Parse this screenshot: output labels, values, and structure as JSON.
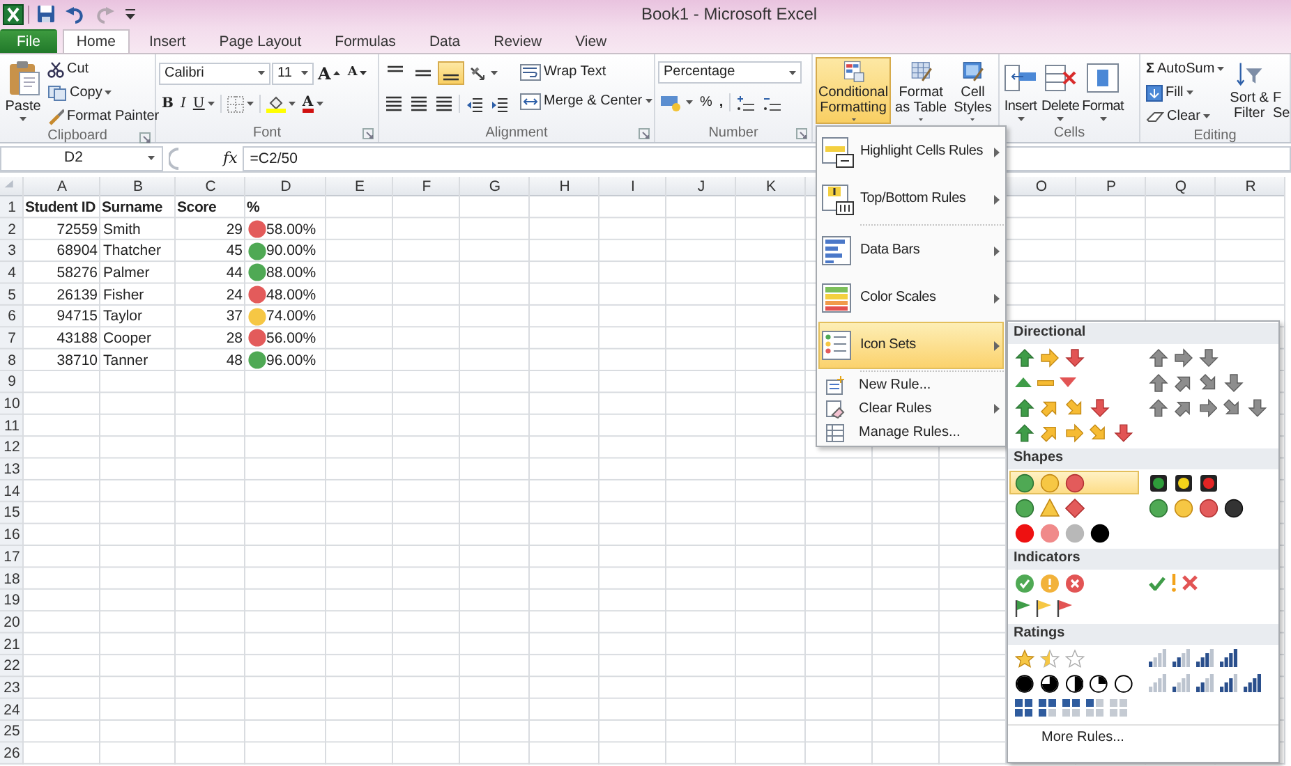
{
  "window": {
    "title": "Book1  -  Microsoft Excel"
  },
  "quick_access": [
    {
      "kind": "save",
      "disabled": false
    },
    {
      "kind": "undo",
      "disabled": false
    },
    {
      "kind": "redo",
      "disabled": true
    },
    {
      "kind": "customize",
      "disabled": false
    }
  ],
  "tabs": [
    {
      "label": "File",
      "kind": "file",
      "selected": false
    },
    {
      "label": "Home",
      "kind": "tab",
      "selected": true
    },
    {
      "label": "Insert",
      "kind": "tab",
      "selected": false
    },
    {
      "label": "Page Layout",
      "kind": "tab",
      "selected": false
    },
    {
      "label": "Formulas",
      "kind": "tab",
      "selected": false
    },
    {
      "label": "Data",
      "kind": "tab",
      "selected": false
    },
    {
      "label": "Review",
      "kind": "tab",
      "selected": false
    },
    {
      "label": "View",
      "kind": "tab",
      "selected": false
    }
  ],
  "ribbon": {
    "clipboard": {
      "paste": "Paste",
      "cut": "Cut",
      "copy": "Copy",
      "format_painter": "Format Painter",
      "label": "Clipboard"
    },
    "font": {
      "family": "Calibri",
      "size": "11",
      "grow": "A",
      "shrink": "A",
      "bold": "B",
      "italic": "I",
      "underline": "U",
      "color_button": "A",
      "label": "Font"
    },
    "alignment": {
      "vertical": [
        {
          "kind": "top",
          "selected": false
        },
        {
          "kind": "middle",
          "selected": false
        },
        {
          "kind": "bottom",
          "selected": true
        }
      ],
      "wrap_text": "Wrap Text",
      "merge": "Merge & Center",
      "label": "Alignment"
    },
    "number": {
      "format": "Percentage",
      "percent": "%",
      "comma": ",",
      "label": "Number"
    },
    "styles": [
      {
        "lines": [
          "Conditional",
          "Formatting"
        ],
        "kind": "conditional",
        "selected": true
      },
      {
        "lines": [
          "Format",
          "as Table"
        ],
        "kind": "table",
        "selected": false
      },
      {
        "lines": [
          "Cell",
          "Styles"
        ],
        "kind": "cellstyles",
        "selected": false
      }
    ],
    "cells": {
      "buttons": [
        {
          "label": "Insert",
          "kind": "insert"
        },
        {
          "label": "Delete",
          "kind": "delete"
        },
        {
          "label": "Format",
          "kind": "format"
        }
      ],
      "label": "Cells"
    },
    "editing": {
      "sigma": "Σ",
      "autosum": "AutoSum",
      "fill": "Fill",
      "clear": "Clear",
      "sort": [
        "Sort &",
        "Filter"
      ],
      "find": [
        "F",
        "Se"
      ],
      "label": "Editing"
    }
  },
  "formula_bar": {
    "name_box": "D2",
    "fx": "fx",
    "formula": "=C2/50"
  },
  "sheet": {
    "columns": [
      "A",
      "B",
      "C",
      "D",
      "E",
      "F",
      "G",
      "H",
      "I",
      "J",
      "K"
    ],
    "columns_right": [
      "O",
      "P",
      "Q",
      "R"
    ],
    "row_numbers": [
      "1",
      "2",
      "3",
      "4",
      "5",
      "6",
      "7",
      "8",
      "9",
      "10",
      "11",
      "12",
      "13",
      "14",
      "15",
      "16",
      "17",
      "18",
      "19",
      "20",
      "21",
      "22",
      "23",
      "24",
      "25",
      "26"
    ],
    "header_row": [
      "Student ID",
      "Surname",
      "Score",
      "%"
    ],
    "rows": [
      {
        "id": "72559",
        "surname": "Smith",
        "score": "29",
        "color": "#e35b5b",
        "percent": "58.00%"
      },
      {
        "id": "68904",
        "surname": "Thatcher",
        "score": "45",
        "color": "#4fa954",
        "percent": "90.00%"
      },
      {
        "id": "58276",
        "surname": "Palmer",
        "score": "44",
        "color": "#4fa954",
        "percent": "88.00%"
      },
      {
        "id": "26139",
        "surname": "Fisher",
        "score": "24",
        "color": "#e35b5b",
        "percent": "48.00%"
      },
      {
        "id": "94715",
        "surname": "Taylor",
        "score": "37",
        "color": "#f6c744",
        "percent": "74.00%"
      },
      {
        "id": "43188",
        "surname": "Cooper",
        "score": "28",
        "color": "#e35b5b",
        "percent": "56.00%"
      },
      {
        "id": "38710",
        "surname": "Tanner",
        "score": "48",
        "color": "#4fa954",
        "percent": "96.00%"
      }
    ]
  },
  "conditional_menu": {
    "groups": [
      [
        {
          "label": "Highlight Cells Rules",
          "kind": "highlight",
          "submenu": true,
          "selected": false
        },
        {
          "label": "Top/Bottom Rules",
          "kind": "topbottom",
          "submenu": true,
          "selected": false
        }
      ],
      [
        {
          "label": "Data Bars",
          "kind": "databars",
          "submenu": true,
          "selected": false
        },
        {
          "label": "Color Scales",
          "kind": "colorscales",
          "submenu": true,
          "selected": false
        },
        {
          "label": "Icon Sets",
          "kind": "iconsets",
          "submenu": true,
          "selected": true
        }
      ],
      [
        {
          "label": "New Rule...",
          "kind": "newrule",
          "submenu": false,
          "selected": false
        },
        {
          "label": "Clear Rules",
          "kind": "clearrules",
          "submenu": true,
          "selected": false
        },
        {
          "label": "Manage Rules...",
          "kind": "managerules",
          "submenu": false,
          "selected": false
        }
      ]
    ]
  },
  "icon_sets": {
    "sections": [
      {
        "title": "Directional",
        "sets": [
          {
            "kind": "arrows3",
            "selected": false
          },
          {
            "kind": "grayarrows3",
            "selected": false
          },
          {
            "kind": "triangles3",
            "selected": false
          },
          {
            "kind": "grayarrows4",
            "selected": false
          },
          {
            "kind": "arrows4",
            "selected": false
          },
          {
            "kind": "grayarrows5",
            "selected": false
          },
          {
            "kind": "arrows5",
            "selected": false
          }
        ]
      },
      {
        "title": "Shapes",
        "sets": [
          {
            "kind": "lights3",
            "selected": true
          },
          {
            "kind": "rimmedlights3",
            "selected": false
          },
          {
            "kind": "signs3",
            "selected": false
          },
          {
            "kind": "lights4",
            "selected": false
          },
          {
            "kind": "redtoblack",
            "selected": false
          }
        ]
      },
      {
        "title": "Indicators",
        "sets": [
          {
            "kind": "circledsymbols3",
            "selected": false
          },
          {
            "kind": "symbols3",
            "selected": false
          },
          {
            "kind": "flags3",
            "selected": false
          }
        ]
      },
      {
        "title": "Ratings",
        "sets": [
          {
            "kind": "stars3",
            "selected": false
          },
          {
            "kind": "ratings4",
            "selected": false
          },
          {
            "kind": "quarters5",
            "selected": false
          },
          {
            "kind": "ratings5",
            "selected": false
          },
          {
            "kind": "boxes5",
            "selected": false
          }
        ]
      }
    ],
    "more": "More Rules..."
  }
}
